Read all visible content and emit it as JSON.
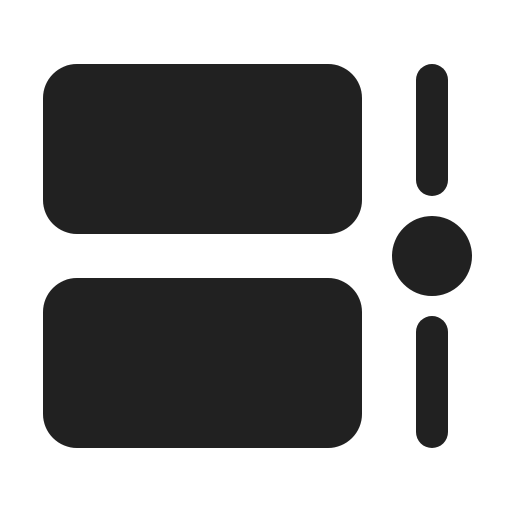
{
  "icon": {
    "name": "list-with-vertical-slider-icon",
    "color": "#212121",
    "background": "#ffffff",
    "slider_position_fraction": 0.5
  }
}
